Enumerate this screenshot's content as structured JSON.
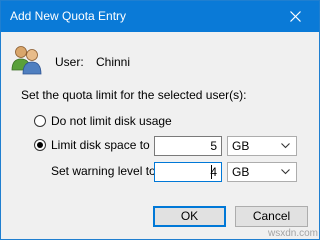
{
  "window": {
    "title": "Add New Quota Entry"
  },
  "user": {
    "label": "User:",
    "name": "Chinni"
  },
  "section_label": "Set the quota limit for the selected user(s):",
  "options": {
    "no_limit_label": "Do not limit disk usage",
    "limit_label": "Limit disk space to",
    "selected": "limit"
  },
  "limit": {
    "value": "5",
    "unit": "GB"
  },
  "warning": {
    "label": "Set warning level to",
    "value": "4",
    "unit": "GB"
  },
  "buttons": {
    "ok": "OK",
    "cancel": "Cancel"
  },
  "watermark": "wsxdn.com",
  "colors": {
    "titlebar": "#0a7ad7",
    "accent": "#0078d7"
  }
}
